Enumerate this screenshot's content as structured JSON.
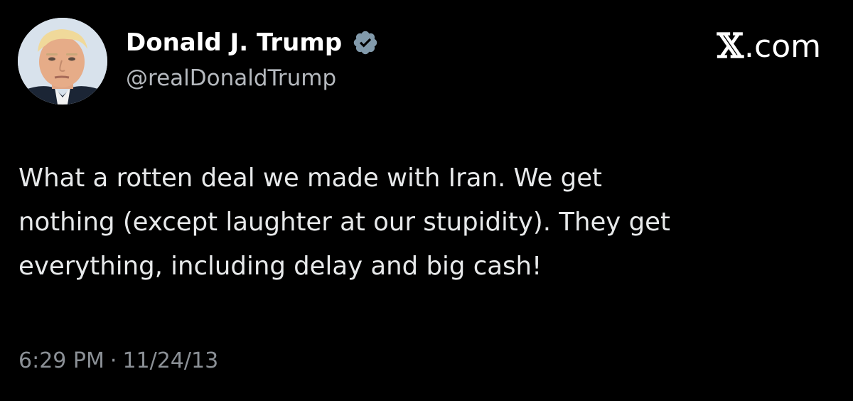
{
  "author": {
    "display_name": "Donald J. Trump",
    "handle": "@realDonaldTrump",
    "verified_icon": "verified-badge-icon",
    "avatar_icon": "profile-photo"
  },
  "brand": {
    "label": ".com",
    "logo_icon": "x-logo-icon"
  },
  "tweet": {
    "lines": [
      "What a rotten deal we made with Iran. We get",
      "nothing (except laughter at our stupidity). They get",
      "everything, including delay and big cash!"
    ]
  },
  "meta": {
    "time": "6:29 PM",
    "separator": "·",
    "date": "11/24/13"
  },
  "colors": {
    "background": "#000000",
    "name": "#ffffff",
    "text": "#e7e9ea",
    "handle": "#b5b9be",
    "meta": "#8b9096",
    "badge": "#829aab"
  }
}
